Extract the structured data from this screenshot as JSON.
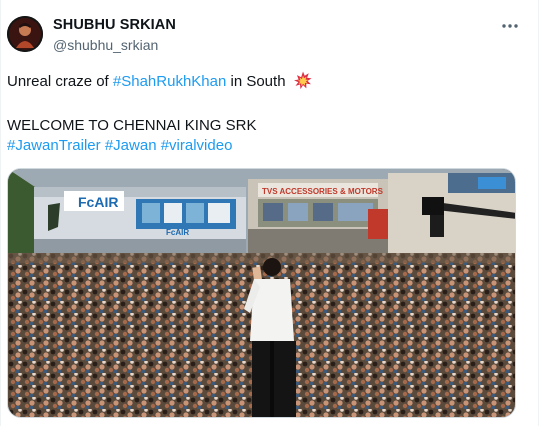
{
  "tweet": {
    "display_name": "SHUBHU SRKIAN",
    "handle": "@shubhu_srkian",
    "line1": {
      "text_before": "Unreal craze of ",
      "hashtag": "#ShahRukhKhan",
      "text_after": " in South",
      "emoji": "collision-emoji"
    },
    "line2": "WELCOME TO CHENNAI KING SRK",
    "hashtags": [
      "#JawanTrailer",
      "#Jawan",
      "#viralvideo"
    ]
  },
  "media": {
    "signs": {
      "store_brand": "FcAIR",
      "store_brand_small": "FcAIR",
      "shop_banner": "TVS ACCESSORIES & MOTORS"
    }
  },
  "colors": {
    "link": "#1d9bf0",
    "text": "#0f1419",
    "secondary": "#536471"
  },
  "icons": [
    "avatar",
    "more-options-icon",
    "collision-emoji"
  ]
}
